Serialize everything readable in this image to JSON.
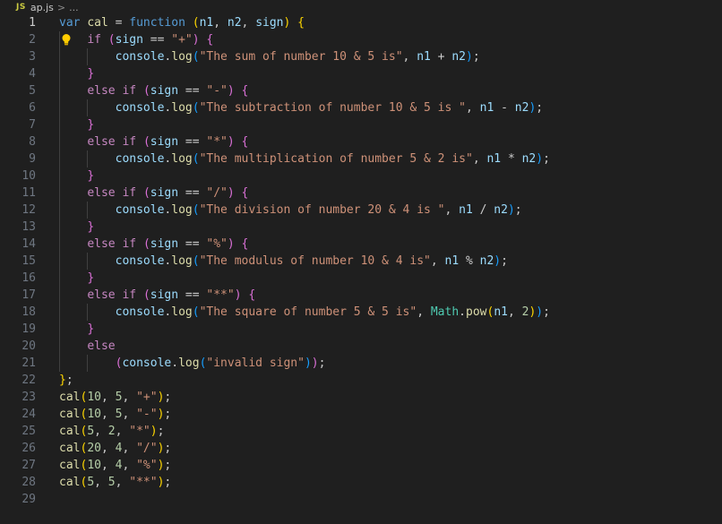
{
  "breadcrumb": {
    "lang_badge": "JS",
    "file": "ap.js",
    "separator": ">",
    "more": "..."
  },
  "editor": {
    "current_line": 1,
    "lines": [
      {
        "n": "1",
        "t": [
          [
            "var",
            "kw"
          ],
          [
            " ",
            ""
          ],
          [
            "cal",
            "fn"
          ],
          [
            " = ",
            ""
          ],
          [
            "function",
            "kw"
          ],
          [
            " ",
            ""
          ],
          [
            "(",
            "b1"
          ],
          [
            "n1",
            "var"
          ],
          [
            ", ",
            ""
          ],
          [
            "n2",
            "var"
          ],
          [
            ", ",
            ""
          ],
          [
            "sign",
            "var"
          ],
          [
            ")",
            "b1"
          ],
          [
            " ",
            ""
          ],
          [
            "{",
            "b1"
          ]
        ]
      },
      {
        "n": "2",
        "t": [
          [
            "    ",
            ""
          ],
          [
            "if",
            "ctl"
          ],
          [
            " ",
            ""
          ],
          [
            "(",
            "b2"
          ],
          [
            "sign",
            "var"
          ],
          [
            " == ",
            ""
          ],
          [
            "\"+\"",
            "str"
          ],
          [
            ")",
            "b2"
          ],
          [
            " ",
            ""
          ],
          [
            "{",
            "b2"
          ]
        ]
      },
      {
        "n": "3",
        "t": [
          [
            "        ",
            ""
          ],
          [
            "console",
            "var"
          ],
          [
            ".",
            ""
          ],
          [
            "log",
            "fn"
          ],
          [
            "(",
            "b3"
          ],
          [
            "\"The sum of number 10 & 5 is\"",
            "str"
          ],
          [
            ", ",
            ""
          ],
          [
            "n1",
            "var"
          ],
          [
            " + ",
            ""
          ],
          [
            "n2",
            "var"
          ],
          [
            ")",
            "b3"
          ],
          [
            ";",
            ""
          ]
        ]
      },
      {
        "n": "4",
        "t": [
          [
            "    ",
            ""
          ],
          [
            "}",
            "b2"
          ]
        ]
      },
      {
        "n": "5",
        "t": [
          [
            "    ",
            ""
          ],
          [
            "else",
            "ctl"
          ],
          [
            " ",
            ""
          ],
          [
            "if",
            "ctl"
          ],
          [
            " ",
            ""
          ],
          [
            "(",
            "b2"
          ],
          [
            "sign",
            "var"
          ],
          [
            " == ",
            ""
          ],
          [
            "\"-\"",
            "str"
          ],
          [
            ")",
            "b2"
          ],
          [
            " ",
            ""
          ],
          [
            "{",
            "b2"
          ]
        ]
      },
      {
        "n": "6",
        "t": [
          [
            "        ",
            ""
          ],
          [
            "console",
            "var"
          ],
          [
            ".",
            ""
          ],
          [
            "log",
            "fn"
          ],
          [
            "(",
            "b3"
          ],
          [
            "\"The subtraction of number 10 & 5 is \"",
            "str"
          ],
          [
            ", ",
            ""
          ],
          [
            "n1",
            "var"
          ],
          [
            " - ",
            ""
          ],
          [
            "n2",
            "var"
          ],
          [
            ")",
            "b3"
          ],
          [
            ";",
            ""
          ]
        ]
      },
      {
        "n": "7",
        "t": [
          [
            "    ",
            ""
          ],
          [
            "}",
            "b2"
          ]
        ]
      },
      {
        "n": "8",
        "t": [
          [
            "    ",
            ""
          ],
          [
            "else",
            "ctl"
          ],
          [
            " ",
            ""
          ],
          [
            "if",
            "ctl"
          ],
          [
            " ",
            ""
          ],
          [
            "(",
            "b2"
          ],
          [
            "sign",
            "var"
          ],
          [
            " == ",
            ""
          ],
          [
            "\"*\"",
            "str"
          ],
          [
            ")",
            "b2"
          ],
          [
            " ",
            ""
          ],
          [
            "{",
            "b2"
          ]
        ]
      },
      {
        "n": "9",
        "t": [
          [
            "        ",
            ""
          ],
          [
            "console",
            "var"
          ],
          [
            ".",
            ""
          ],
          [
            "log",
            "fn"
          ],
          [
            "(",
            "b3"
          ],
          [
            "\"The multiplication of number 5 & 2 is\"",
            "str"
          ],
          [
            ", ",
            ""
          ],
          [
            "n1",
            "var"
          ],
          [
            " * ",
            ""
          ],
          [
            "n2",
            "var"
          ],
          [
            ")",
            "b3"
          ],
          [
            ";",
            ""
          ]
        ]
      },
      {
        "n": "10",
        "t": [
          [
            "    ",
            ""
          ],
          [
            "}",
            "b2"
          ]
        ]
      },
      {
        "n": "11",
        "t": [
          [
            "    ",
            ""
          ],
          [
            "else",
            "ctl"
          ],
          [
            " ",
            ""
          ],
          [
            "if",
            "ctl"
          ],
          [
            " ",
            ""
          ],
          [
            "(",
            "b2"
          ],
          [
            "sign",
            "var"
          ],
          [
            " == ",
            ""
          ],
          [
            "\"/\"",
            "str"
          ],
          [
            ")",
            "b2"
          ],
          [
            " ",
            ""
          ],
          [
            "{",
            "b2"
          ]
        ]
      },
      {
        "n": "12",
        "t": [
          [
            "        ",
            ""
          ],
          [
            "console",
            "var"
          ],
          [
            ".",
            ""
          ],
          [
            "log",
            "fn"
          ],
          [
            "(",
            "b3"
          ],
          [
            "\"The division of number 20 & 4 is \"",
            "str"
          ],
          [
            ", ",
            ""
          ],
          [
            "n1",
            "var"
          ],
          [
            " / ",
            ""
          ],
          [
            "n2",
            "var"
          ],
          [
            ")",
            "b3"
          ],
          [
            ";",
            ""
          ]
        ]
      },
      {
        "n": "13",
        "t": [
          [
            "    ",
            ""
          ],
          [
            "}",
            "b2"
          ]
        ]
      },
      {
        "n": "14",
        "t": [
          [
            "    ",
            ""
          ],
          [
            "else",
            "ctl"
          ],
          [
            " ",
            ""
          ],
          [
            "if",
            "ctl"
          ],
          [
            " ",
            ""
          ],
          [
            "(",
            "b2"
          ],
          [
            "sign",
            "var"
          ],
          [
            " == ",
            ""
          ],
          [
            "\"%\"",
            "str"
          ],
          [
            ")",
            "b2"
          ],
          [
            " ",
            ""
          ],
          [
            "{",
            "b2"
          ]
        ]
      },
      {
        "n": "15",
        "t": [
          [
            "        ",
            ""
          ],
          [
            "console",
            "var"
          ],
          [
            ".",
            ""
          ],
          [
            "log",
            "fn"
          ],
          [
            "(",
            "b3"
          ],
          [
            "\"The modulus of number 10 & 4 is\"",
            "str"
          ],
          [
            ", ",
            ""
          ],
          [
            "n1",
            "var"
          ],
          [
            " % ",
            ""
          ],
          [
            "n2",
            "var"
          ],
          [
            ")",
            "b3"
          ],
          [
            ";",
            ""
          ]
        ]
      },
      {
        "n": "16",
        "t": [
          [
            "    ",
            ""
          ],
          [
            "}",
            "b2"
          ]
        ]
      },
      {
        "n": "17",
        "t": [
          [
            "    ",
            ""
          ],
          [
            "else",
            "ctl"
          ],
          [
            " ",
            ""
          ],
          [
            "if",
            "ctl"
          ],
          [
            " ",
            ""
          ],
          [
            "(",
            "b2"
          ],
          [
            "sign",
            "var"
          ],
          [
            " == ",
            ""
          ],
          [
            "\"**\"",
            "str"
          ],
          [
            ")",
            "b2"
          ],
          [
            " ",
            ""
          ],
          [
            "{",
            "b2"
          ]
        ]
      },
      {
        "n": "18",
        "t": [
          [
            "        ",
            ""
          ],
          [
            "console",
            "var"
          ],
          [
            ".",
            ""
          ],
          [
            "log",
            "fn"
          ],
          [
            "(",
            "b3"
          ],
          [
            "\"The square of number 5 & 5 is\"",
            "str"
          ],
          [
            ", ",
            ""
          ],
          [
            "Math",
            "cls"
          ],
          [
            ".",
            ""
          ],
          [
            "pow",
            "fn"
          ],
          [
            "(",
            "b1"
          ],
          [
            "n1",
            "var"
          ],
          [
            ", ",
            ""
          ],
          [
            "2",
            "num"
          ],
          [
            ")",
            "b1"
          ],
          [
            ")",
            "b3"
          ],
          [
            ";",
            ""
          ]
        ]
      },
      {
        "n": "19",
        "t": [
          [
            "    ",
            ""
          ],
          [
            "}",
            "b2"
          ]
        ]
      },
      {
        "n": "20",
        "t": [
          [
            "    ",
            ""
          ],
          [
            "else",
            "ctl"
          ]
        ]
      },
      {
        "n": "21",
        "t": [
          [
            "        ",
            ""
          ],
          [
            "(",
            "b2"
          ],
          [
            "console",
            "var"
          ],
          [
            ".",
            ""
          ],
          [
            "log",
            "fn"
          ],
          [
            "(",
            "b3"
          ],
          [
            "\"invalid sign\"",
            "str"
          ],
          [
            ")",
            "b3"
          ],
          [
            ")",
            "b2"
          ],
          [
            ";",
            ""
          ]
        ]
      },
      {
        "n": "22",
        "t": [
          [
            "}",
            "b1"
          ],
          [
            ";",
            ""
          ]
        ]
      },
      {
        "n": "23",
        "t": [
          [
            "cal",
            "fn"
          ],
          [
            "(",
            "b1"
          ],
          [
            "10",
            "num"
          ],
          [
            ", ",
            ""
          ],
          [
            "5",
            "num"
          ],
          [
            ", ",
            ""
          ],
          [
            "\"+\"",
            "str"
          ],
          [
            ")",
            "b1"
          ],
          [
            ";",
            ""
          ]
        ]
      },
      {
        "n": "24",
        "t": [
          [
            "cal",
            "fn"
          ],
          [
            "(",
            "b1"
          ],
          [
            "10",
            "num"
          ],
          [
            ", ",
            ""
          ],
          [
            "5",
            "num"
          ],
          [
            ", ",
            ""
          ],
          [
            "\"-\"",
            "str"
          ],
          [
            ")",
            "b1"
          ],
          [
            ";",
            ""
          ]
        ]
      },
      {
        "n": "25",
        "t": [
          [
            "cal",
            "fn"
          ],
          [
            "(",
            "b1"
          ],
          [
            "5",
            "num"
          ],
          [
            ", ",
            ""
          ],
          [
            "2",
            "num"
          ],
          [
            ", ",
            ""
          ],
          [
            "\"*\"",
            "str"
          ],
          [
            ")",
            "b1"
          ],
          [
            ";",
            ""
          ]
        ]
      },
      {
        "n": "26",
        "t": [
          [
            "cal",
            "fn"
          ],
          [
            "(",
            "b1"
          ],
          [
            "20",
            "num"
          ],
          [
            ", ",
            ""
          ],
          [
            "4",
            "num"
          ],
          [
            ", ",
            ""
          ],
          [
            "\"/\"",
            "str"
          ],
          [
            ")",
            "b1"
          ],
          [
            ";",
            ""
          ]
        ]
      },
      {
        "n": "27",
        "t": [
          [
            "cal",
            "fn"
          ],
          [
            "(",
            "b1"
          ],
          [
            "10",
            "num"
          ],
          [
            ", ",
            ""
          ],
          [
            "4",
            "num"
          ],
          [
            ", ",
            ""
          ],
          [
            "\"%\"",
            "str"
          ],
          [
            ")",
            "b1"
          ],
          [
            ";",
            ""
          ]
        ]
      },
      {
        "n": "28",
        "t": [
          [
            "cal",
            "fn"
          ],
          [
            "(",
            "b1"
          ],
          [
            "5",
            "num"
          ],
          [
            ", ",
            ""
          ],
          [
            "5",
            "num"
          ],
          [
            ", ",
            ""
          ],
          [
            "\"**\"",
            "str"
          ],
          [
            ")",
            "b1"
          ],
          [
            ";",
            ""
          ]
        ]
      },
      {
        "n": "29",
        "t": []
      }
    ]
  },
  "colors": {
    "background": "#1f1f1f",
    "keyword": "#569cd6",
    "control": "#c586c0",
    "variable": "#9cdcfe",
    "function": "#dcdcaa",
    "string": "#ce9178",
    "number": "#b5cea8",
    "bracket_1": "#ffd700",
    "bracket_2": "#da70d6",
    "bracket_3": "#179fff"
  },
  "icons": {
    "lightbulb": "lightbulb-icon",
    "language": "javascript-file-icon"
  }
}
